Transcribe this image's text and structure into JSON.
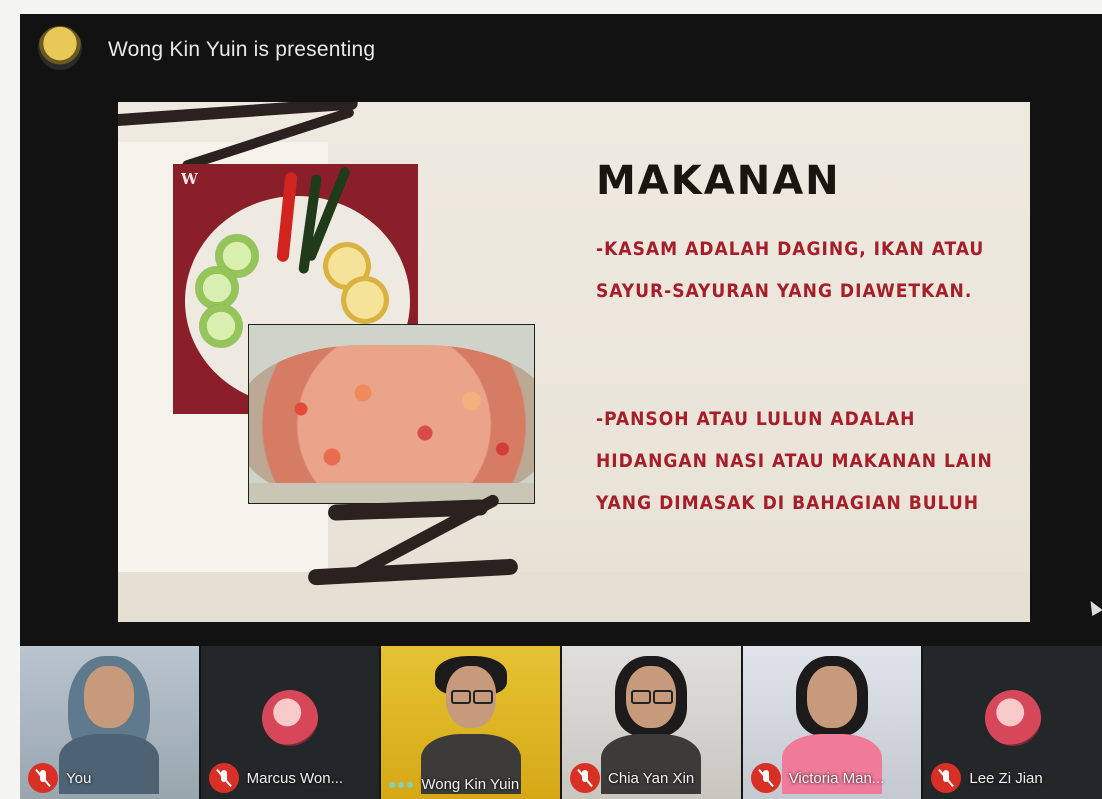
{
  "presenter": {
    "banner_text": "Wong Kin Yuin is presenting"
  },
  "slide": {
    "title": "MAKANAN",
    "paragraph_1": "-Kasam adalah daging, ikan atau sayur-sayuran yang diawetkan.",
    "paragraph_2": "-Pansoh atau lulun adalah hidangan nasi atau makanan lain yang dimasak di bahagian buluh",
    "photo_brand_mark": "W",
    "text_color": "#a51e2a"
  },
  "participants": [
    {
      "name": "You",
      "muted": true
    },
    {
      "name": "Marcus Won...",
      "muted": true
    },
    {
      "name": "Wong Kin Yuin",
      "muted": false,
      "speaking": true
    },
    {
      "name": "Chia Yan Xin",
      "muted": true
    },
    {
      "name": "Victoria Man...",
      "muted": true
    },
    {
      "name": "Lee Zi Jian",
      "muted": true
    }
  ],
  "colors": {
    "mute_badge": "#d93025",
    "background": "#121212"
  }
}
